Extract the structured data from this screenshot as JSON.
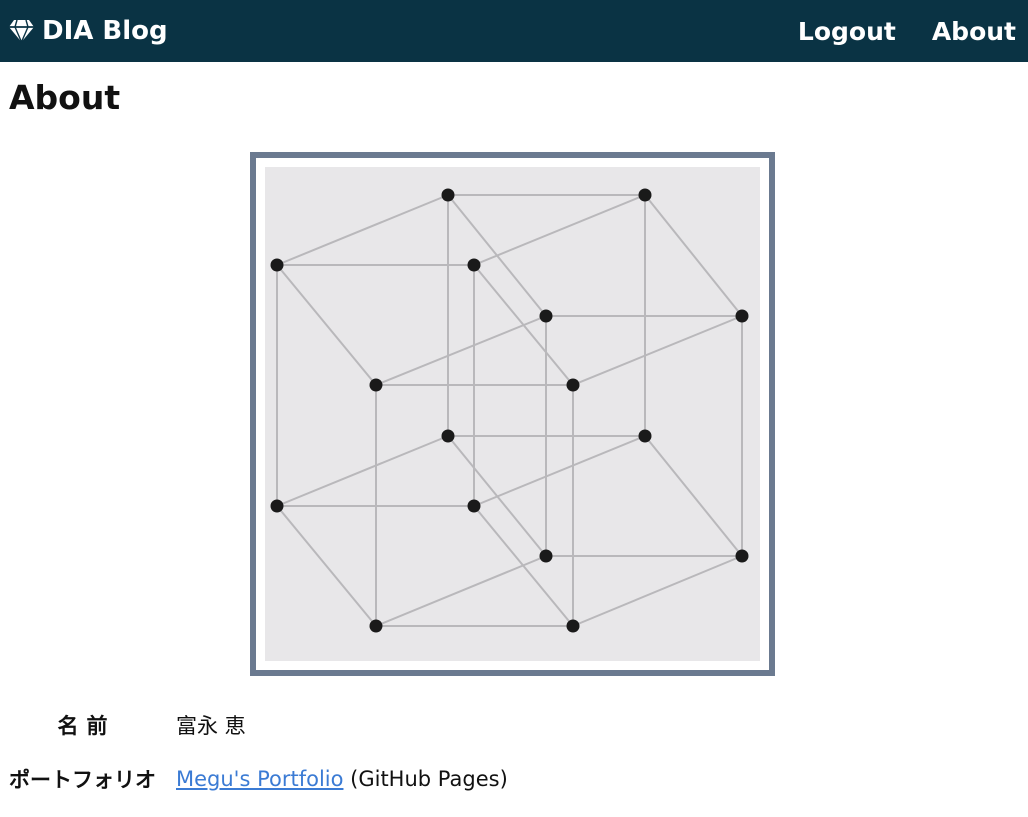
{
  "navbar": {
    "brand_label": "DIA Blog",
    "brand_icon": "gem-icon",
    "links": [
      {
        "label": "Logout"
      },
      {
        "label": "About"
      }
    ],
    "background": "#0a3344"
  },
  "page": {
    "title": "About"
  },
  "avatar": {
    "icon": "tesseract-image",
    "frame_color": "#6b7a90"
  },
  "profile": {
    "name_label": "名前",
    "name_value": "富永 恵",
    "portfolio_label": "ポートフォリオ",
    "portfolio_link_text": "Megu's Portfolio",
    "portfolio_suffix": " (GitHub Pages)",
    "link_color": "#3b7bd4"
  }
}
